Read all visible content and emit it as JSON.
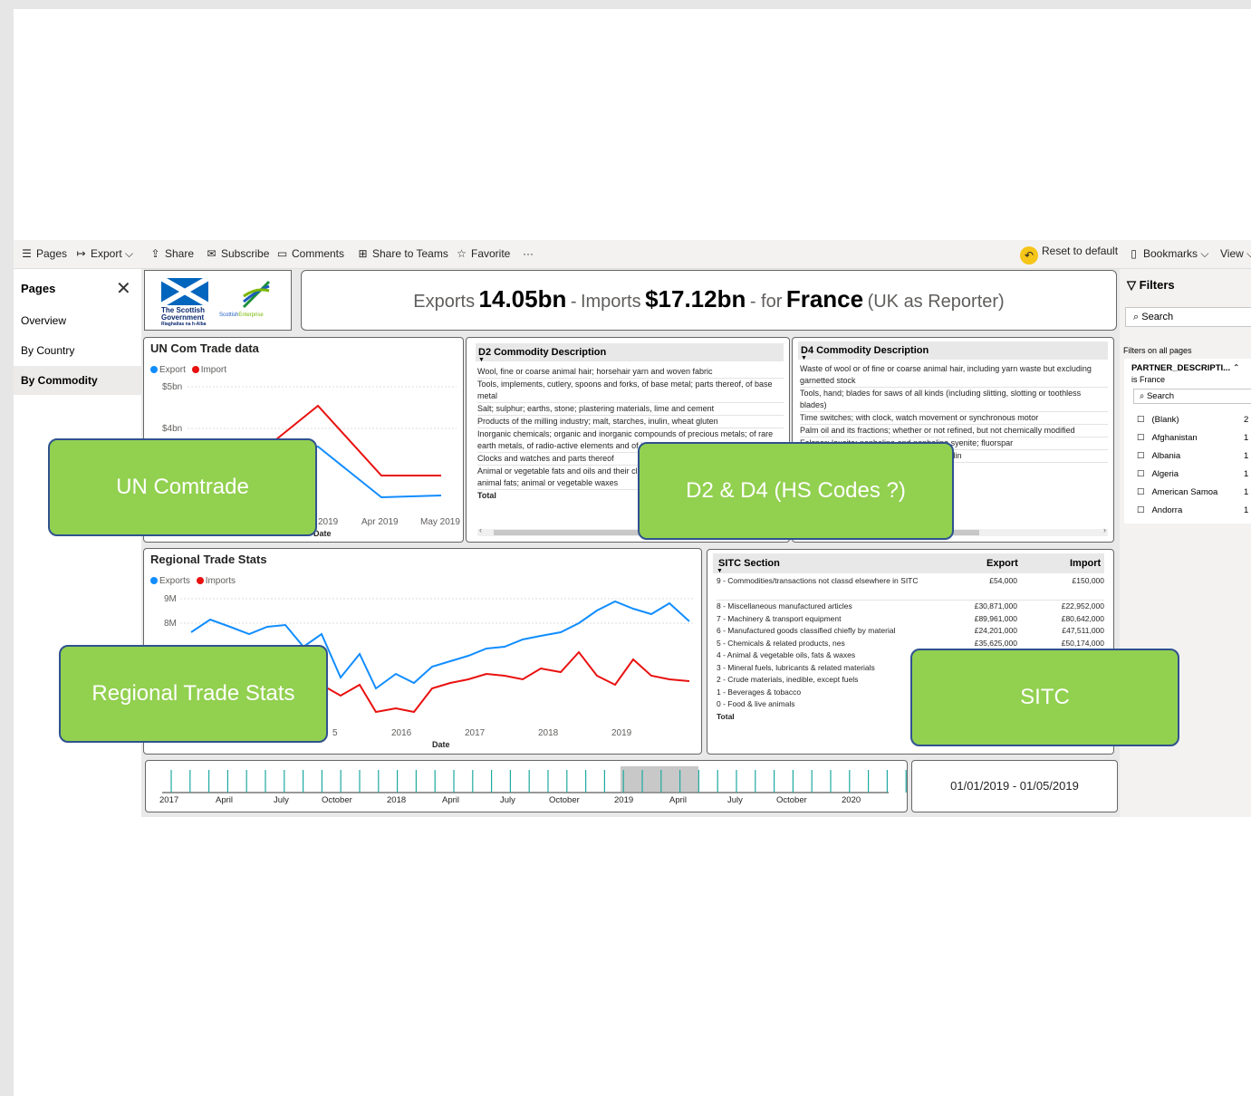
{
  "toolbar": {
    "pages": "Pages",
    "export": "Export",
    "share": "Share",
    "subscribe": "Subscribe",
    "comments": "Comments",
    "share_teams": "Share to Teams",
    "favorite": "Favorite",
    "more": "···",
    "reset": "Reset to default",
    "bookmarks": "Bookmarks",
    "view": "View"
  },
  "pages_panel": {
    "title": "Pages",
    "items": [
      {
        "label": "Overview"
      },
      {
        "label": "By Country"
      },
      {
        "label": "By Commodity"
      }
    ]
  },
  "logo": {
    "gov_line1": "The Scottish",
    "gov_line2": "Government",
    "gov_line3": "Riaghaltas na h-Alba",
    "se_name": "Scottish",
    "se_name2": "Enterprise"
  },
  "banner": {
    "exports_label": "Exports",
    "exports_value": "14.05bn",
    "sep1": "-",
    "imports_label": "Imports",
    "imports_value": "$17.12bn",
    "sep2": "- for",
    "country": "France",
    "suffix": "(UK as Reporter)"
  },
  "un_chart": {
    "title": "UN Com Trade data",
    "legend_export": "Export",
    "legend_import": "Import",
    "y_ticks": [
      "$5bn",
      "$4bn"
    ],
    "x_ticks": [
      "2019",
      "Apr 2019",
      "May 2019"
    ],
    "xlabel": "Date",
    "colors": {
      "export": "#118dff",
      "import": "#e8110f"
    }
  },
  "d2_table": {
    "header": "D2 Commodity Description",
    "rows": [
      "Wool, fine or coarse animal hair; horsehair yarn and woven fabric",
      "Tools, implements, cutlery, spoons and forks, of base metal; parts thereof, of base metal",
      "Salt; sulphur; earths, stone; plastering materials, lime and cement",
      "Products of the milling industry; malt, starches, inulin, wheat gluten",
      "Inorganic chemicals; organic and inorganic compounds of precious metals; of rare earth metals, of radio-active elements and of isotopes",
      "Clocks and watches and parts thereof",
      "Animal or vegetable fats and oils and their cleavage products; prepared edible animal fats; animal or vegetable waxes"
    ],
    "total": "Total"
  },
  "d4_table": {
    "header": "D4 Commodity Description",
    "rows": [
      "Waste of wool or of fine or coarse animal hair, including yarn waste but excluding garnetted stock",
      "Tools, hand; blades for saws of all kinds (including slitting, slotting or toothless blades)",
      "Time switches; with clock, watch movement or synchronous motor",
      "Palm oil and its fractions; whether or not refined, but not chemically modified",
      "Felspar; leucite; nepheline and nepheline syenite; fluorspar",
      "eslin"
    ]
  },
  "regional_chart": {
    "title": "Regional Trade Stats",
    "legend_exports": "Exports",
    "legend_imports": "Imports",
    "y_ticks": [
      "9M",
      "8M"
    ],
    "x_ticks": [
      "5",
      "2016",
      "2017",
      "2018",
      "2019"
    ],
    "xlabel": "Date"
  },
  "sitc_table": {
    "col_section": "SITC Section",
    "col_export": "Export",
    "col_import": "Import",
    "rows": [
      {
        "section": "9 - Commodities/transactions not classd elsewhere in SITC",
        "export": "£54,000",
        "import": "£150,000"
      },
      {
        "section": "8 - Miscellaneous manufactured articles",
        "export": "£30,871,000",
        "import": "£22,952,000"
      },
      {
        "section": "7 - Machinery & transport equipment",
        "export": "£89,961,000",
        "import": "£80,642,000"
      },
      {
        "section": "6 - Manufactured goods classified chiefly by material",
        "export": "£24,201,000",
        "import": "£47,511,000"
      },
      {
        "section": "5 - Chemicals & related products, nes",
        "export": "£35,625,000",
        "import": "£50,174,000"
      },
      {
        "section": "4 - Animal & vegetable oils, fats & waxes",
        "export": "",
        "import": ""
      },
      {
        "section": "3 - Mineral fuels, lubricants & related materials",
        "export": "",
        "import": ""
      },
      {
        "section": "2 - Crude materials, inedible, except fuels",
        "export": "",
        "import": ""
      },
      {
        "section": "1 - Beverages & tobacco",
        "export": "",
        "import": ""
      },
      {
        "section": "0 - Food & live animals",
        "export": "",
        "import": ""
      }
    ],
    "total": "Total"
  },
  "timeline": {
    "labels": [
      "2017",
      "April",
      "July",
      "October",
      "2018",
      "April",
      "July",
      "October",
      "2019",
      "April",
      "July",
      "October",
      "2020"
    ],
    "selected_range": "01/01/2019 - 01/05/2019"
  },
  "filters": {
    "title": "Filters",
    "search_placeholder": "Search",
    "section": "Filters on all pages",
    "card_title": "PARTNER_DESCRIPTI...",
    "card_sub": "is France",
    "card_search": "Search",
    "options": [
      {
        "label": "(Blank)",
        "count": "2"
      },
      {
        "label": "Afghanistan",
        "count": "1"
      },
      {
        "label": "Albania",
        "count": "1"
      },
      {
        "label": "Algeria",
        "count": "1"
      },
      {
        "label": "American Samoa",
        "count": "1"
      },
      {
        "label": "Andorra",
        "count": "1"
      }
    ]
  },
  "overlays": {
    "un": "UN Comtrade",
    "d2d4": "D2 & D4  (HS Codes ?)",
    "regional": "Regional Trade Stats",
    "sitc": "SITC"
  }
}
